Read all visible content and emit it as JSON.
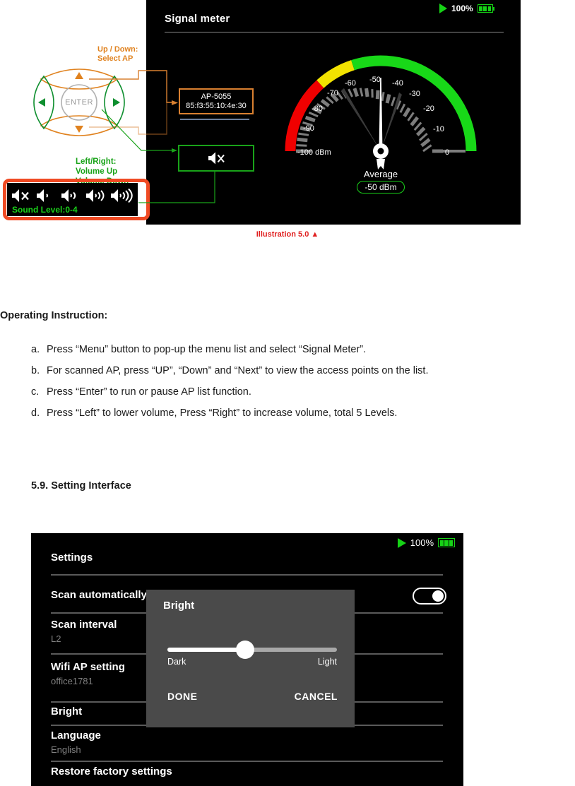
{
  "signal_screen": {
    "title": "Signal meter",
    "status": {
      "play_icon": "play-icon",
      "battery_pct": "100%",
      "battery_icon": "battery-full-icon"
    },
    "ap_box": {
      "name": "AP-5055",
      "mac": "85:f3:55:10:4e:30"
    },
    "mute_box": {
      "icon": "speaker-mute-icon"
    },
    "gauge": {
      "tick_labels": [
        "-100 dBm",
        "-90",
        "-80",
        "-70",
        "-60",
        "-50",
        "-40",
        "-30",
        "-20",
        "-10",
        "0"
      ],
      "average_label": "Average",
      "average_value": "-50 dBm",
      "zone_red": "#f00000",
      "zone_yellow": "#f2e200",
      "zone_green": "#18d818"
    }
  },
  "keypad": {
    "enter_label": "ENTER",
    "up_icon": "arrow-up-icon",
    "down_icon": "arrow-down-icon",
    "left_icon": "arrow-left-icon",
    "right_icon": "arrow-right-icon",
    "annotation_updown": "Up / Down:\nSelect AP",
    "annotation_leftright": "Left/Right:\nVolume Up\nVolume Down",
    "annotation_updown_color": "#e0821f",
    "annotation_leftright_color": "#19a319"
  },
  "volume_strip": {
    "icons": [
      "speaker-mute-icon",
      "speaker-level1-icon",
      "speaker-level2-icon",
      "speaker-level3-icon",
      "speaker-level4-icon"
    ],
    "sound_level_text": "Sound Level:0-4",
    "highlight_color": "#f04a23"
  },
  "caption": "Illustration 5.0 ▲",
  "document": {
    "heading": "Operating Instruction:",
    "steps": [
      {
        "marker": "a.",
        "text": "Press “Menu” button to pop-up the menu list and select “Signal Meter”."
      },
      {
        "marker": "b.",
        "text": "For scanned AP, press “UP”, “Down” and “Next” to view the access points on the list."
      },
      {
        "marker": "c.",
        "text": "Press “Enter” to run or pause AP list function."
      },
      {
        "marker": "d.",
        "text": "Press “Left” to lower volume, Press “Right” to increase volume, total 5 Levels."
      }
    ],
    "section_heading": "5.9. Setting Interface"
  },
  "settings_screen": {
    "title": "Settings",
    "status": {
      "play_icon": "play-icon",
      "battery_pct": "100%",
      "battery_icon": "battery-full-icon"
    },
    "rows": [
      {
        "label": "Scan automatically",
        "value": "",
        "control": "toggle-on"
      },
      {
        "label": "Scan interval",
        "value": "L2",
        "control": ""
      },
      {
        "label": "Wifi AP setting",
        "value": "office1781",
        "control": ""
      },
      {
        "label": "Bright",
        "value": "",
        "control": ""
      },
      {
        "label": "Language",
        "value": "English",
        "control": ""
      },
      {
        "label": "Restore factory settings",
        "value": "",
        "control": ""
      }
    ],
    "dialog": {
      "title": "Bright",
      "slider_min_label": "Dark",
      "slider_max_label": "Light",
      "slider_percent": 46,
      "done_label": "DONE",
      "cancel_label": "CANCEL"
    }
  }
}
